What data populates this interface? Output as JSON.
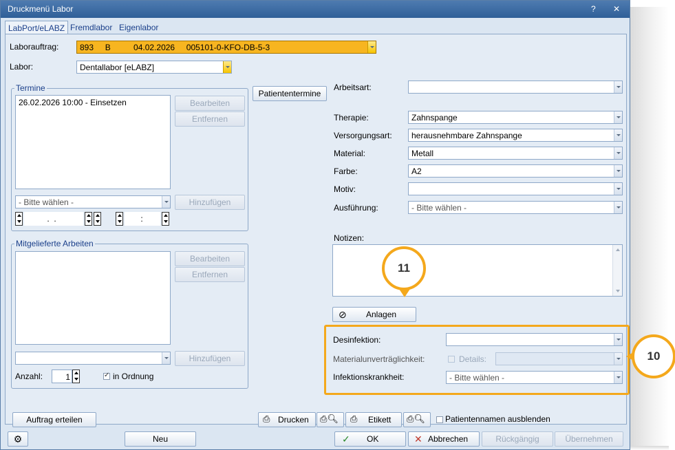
{
  "window": {
    "title": "Druckmenü Labor",
    "help_btn": "?",
    "close_btn": "✕"
  },
  "tabs": [
    {
      "label": "LabPort/eLABZ",
      "active": true
    },
    {
      "label": "Fremdlabor",
      "active": false
    },
    {
      "label": "Eigenlabor",
      "active": false
    }
  ],
  "header": {
    "laborauftrag_label": "Laborauftrag:",
    "laborauftrag_value": "893     B          04.02.2026     005101-0-KFO-DB-5-3",
    "labor_label": "Labor:",
    "labor_value": "Dentallabor [eLABZ]"
  },
  "termine": {
    "title": "Termine",
    "items": [
      "26.02.2026 10:00 - Einsetzen"
    ],
    "bearbeiten": "Bearbeiten",
    "entfernen": "Entfernen",
    "select_placeholder": "- Bitte wählen -",
    "hinzufuegen": "Hinzufügen",
    "date_value": " .  .",
    "time_value": " :",
    "patiententermine": "Patiententermine"
  },
  "mitgeliefert": {
    "title": "Mitgelieferte Arbeiten",
    "bearbeiten": "Bearbeiten",
    "entfernen": "Entfernen",
    "hinzufuegen": "Hinzufügen",
    "anzahl_label": "Anzahl:",
    "anzahl_value": "1",
    "in_ordnung_label": "in Ordnung",
    "in_ordnung_checked": true
  },
  "right": {
    "arbeitsart_label": "Arbeitsart:",
    "arbeitsart_value": "",
    "therapie_label": "Therapie:",
    "therapie_value": "Zahnspange",
    "versorgungsart_label": "Versorgungsart:",
    "versorgungsart_value": "herausnehmbare Zahnspange",
    "material_label": "Material:",
    "material_value": "Metall",
    "farbe_label": "Farbe:",
    "farbe_value": "A2",
    "motiv_label": "Motiv:",
    "motiv_value": "",
    "ausfuehrung_label": "Ausführung:",
    "ausfuehrung_value": "- Bitte wählen -",
    "notizen_label": "Notizen:",
    "anlagen": "Anlagen"
  },
  "hygiene": {
    "desinfektion_label": "Desinfektion:",
    "desinfektion_value": "",
    "materialunvertraeglichkeit_label": "Materialunverträglichkeit:",
    "details_label": "Details:",
    "infektionskrankheit_label": "Infektionskrankheit:",
    "infektionskrankheit_value": "- Bitte wählen -"
  },
  "callouts": {
    "c10": "10",
    "c11": "11"
  },
  "bottom": {
    "auftrag_erteilen": "Auftrag erteilen",
    "drucken": "Drucken",
    "etikett": "Etikett",
    "patientennamen": "Patientennamen ausblenden"
  },
  "statusbar": {
    "neu": "Neu",
    "ok": "OK",
    "abbrechen": "Abbrechen",
    "rueckgaengig": "Rückgängig",
    "uebernehmen": "Übernehmen"
  },
  "colors": {
    "accent": "#f4a81c",
    "titlebar": "#3a6aa3",
    "orange_field": "#f7b520"
  }
}
